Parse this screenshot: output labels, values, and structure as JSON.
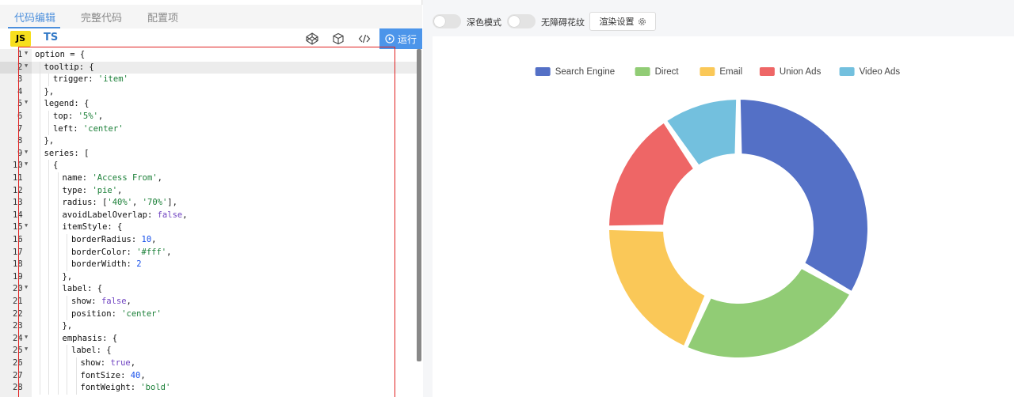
{
  "tabs": [
    {
      "label": "代码编辑",
      "active": true
    },
    {
      "label": "完整代码",
      "active": false
    },
    {
      "label": "配置项",
      "active": false
    }
  ],
  "toolbar": {
    "js_label": "JS",
    "ts_label": "TS",
    "icons": [
      "codepen-icon",
      "cube-icon",
      "code-icon"
    ],
    "run_label": "运行"
  },
  "editor": {
    "active_line": 2,
    "lines": [
      {
        "n": "1",
        "fold": true,
        "indent": 0,
        "tokens": [
          [
            "p",
            "option = {"
          ]
        ]
      },
      {
        "n": "2",
        "fold": true,
        "indent": 1,
        "tokens": [
          [
            "p",
            "tooltip: {"
          ]
        ]
      },
      {
        "n": "3",
        "fold": false,
        "indent": 2,
        "tokens": [
          [
            "p",
            "trigger: "
          ],
          [
            "s",
            "'item'"
          ]
        ]
      },
      {
        "n": "4",
        "fold": false,
        "indent": 1,
        "tokens": [
          [
            "p",
            "},"
          ]
        ]
      },
      {
        "n": "5",
        "fold": true,
        "indent": 1,
        "tokens": [
          [
            "p",
            "legend: {"
          ]
        ]
      },
      {
        "n": "6",
        "fold": false,
        "indent": 2,
        "tokens": [
          [
            "p",
            "top: "
          ],
          [
            "s",
            "'5%'"
          ],
          [
            "p",
            ","
          ]
        ]
      },
      {
        "n": "7",
        "fold": false,
        "indent": 2,
        "tokens": [
          [
            "p",
            "left: "
          ],
          [
            "s",
            "'center'"
          ]
        ]
      },
      {
        "n": "8",
        "fold": false,
        "indent": 1,
        "tokens": [
          [
            "p",
            "},"
          ]
        ]
      },
      {
        "n": "9",
        "fold": true,
        "indent": 1,
        "tokens": [
          [
            "p",
            "series: ["
          ]
        ]
      },
      {
        "n": "10",
        "fold": true,
        "indent": 2,
        "tokens": [
          [
            "p",
            "{"
          ]
        ]
      },
      {
        "n": "11",
        "fold": false,
        "indent": 3,
        "tokens": [
          [
            "p",
            "name: "
          ],
          [
            "s",
            "'Access From'"
          ],
          [
            "p",
            ","
          ]
        ]
      },
      {
        "n": "12",
        "fold": false,
        "indent": 3,
        "tokens": [
          [
            "p",
            "type: "
          ],
          [
            "s",
            "'pie'"
          ],
          [
            "p",
            ","
          ]
        ]
      },
      {
        "n": "13",
        "fold": false,
        "indent": 3,
        "tokens": [
          [
            "p",
            "radius: ["
          ],
          [
            "s",
            "'40%'"
          ],
          [
            "p",
            ", "
          ],
          [
            "s",
            "'70%'"
          ],
          [
            "p",
            "],"
          ]
        ]
      },
      {
        "n": "14",
        "fold": false,
        "indent": 3,
        "tokens": [
          [
            "p",
            "avoidLabelOverlap: "
          ],
          [
            "k",
            "false"
          ],
          [
            "p",
            ","
          ]
        ]
      },
      {
        "n": "15",
        "fold": true,
        "indent": 3,
        "tokens": [
          [
            "p",
            "itemStyle: {"
          ]
        ]
      },
      {
        "n": "16",
        "fold": false,
        "indent": 4,
        "tokens": [
          [
            "p",
            "borderRadius: "
          ],
          [
            "n",
            "10"
          ],
          [
            "p",
            ","
          ]
        ]
      },
      {
        "n": "17",
        "fold": false,
        "indent": 4,
        "tokens": [
          [
            "p",
            "borderColor: "
          ],
          [
            "s",
            "'#fff'"
          ],
          [
            "p",
            ","
          ]
        ]
      },
      {
        "n": "18",
        "fold": false,
        "indent": 4,
        "tokens": [
          [
            "p",
            "borderWidth: "
          ],
          [
            "n",
            "2"
          ]
        ]
      },
      {
        "n": "19",
        "fold": false,
        "indent": 3,
        "tokens": [
          [
            "p",
            "},"
          ]
        ]
      },
      {
        "n": "20",
        "fold": true,
        "indent": 3,
        "tokens": [
          [
            "p",
            "label: {"
          ]
        ]
      },
      {
        "n": "21",
        "fold": false,
        "indent": 4,
        "tokens": [
          [
            "p",
            "show: "
          ],
          [
            "k",
            "false"
          ],
          [
            "p",
            ","
          ]
        ]
      },
      {
        "n": "22",
        "fold": false,
        "indent": 4,
        "tokens": [
          [
            "p",
            "position: "
          ],
          [
            "s",
            "'center'"
          ]
        ]
      },
      {
        "n": "23",
        "fold": false,
        "indent": 3,
        "tokens": [
          [
            "p",
            "},"
          ]
        ]
      },
      {
        "n": "24",
        "fold": true,
        "indent": 3,
        "tokens": [
          [
            "p",
            "emphasis: {"
          ]
        ]
      },
      {
        "n": "25",
        "fold": true,
        "indent": 4,
        "tokens": [
          [
            "p",
            "label: {"
          ]
        ]
      },
      {
        "n": "26",
        "fold": false,
        "indent": 5,
        "tokens": [
          [
            "p",
            "show: "
          ],
          [
            "k",
            "true"
          ],
          [
            "p",
            ","
          ]
        ]
      },
      {
        "n": "27",
        "fold": false,
        "indent": 5,
        "tokens": [
          [
            "p",
            "fontSize: "
          ],
          [
            "n",
            "40"
          ],
          [
            "p",
            ","
          ]
        ]
      },
      {
        "n": "28",
        "fold": false,
        "indent": 5,
        "tokens": [
          [
            "p",
            "fontWeight: "
          ],
          [
            "s",
            "'bold'"
          ]
        ]
      }
    ]
  },
  "preview": {
    "dark_mode_label": "深色模式",
    "dark_mode_on": false,
    "accessible_label": "无障碍花纹",
    "accessible_on": false,
    "render_settings_label": "渲染设置"
  },
  "colors": {
    "accent": "#4c8fdc",
    "run_button": "#4c95ea",
    "highlight_box": "#e02020"
  },
  "chart_data": {
    "type": "pie",
    "donut": true,
    "inner_radius": "40%",
    "outer_radius": "70%",
    "legend_position": "top-center",
    "series": [
      {
        "name": "Search Engine",
        "value": 1048,
        "color": "#5470c6"
      },
      {
        "name": "Direct",
        "value": 735,
        "color": "#91cc75"
      },
      {
        "name": "Email",
        "value": 580,
        "color": "#fac858"
      },
      {
        "name": "Union Ads",
        "value": 484,
        "color": "#ee6666"
      },
      {
        "name": "Video Ads",
        "value": 300,
        "color": "#73c0de"
      }
    ]
  }
}
